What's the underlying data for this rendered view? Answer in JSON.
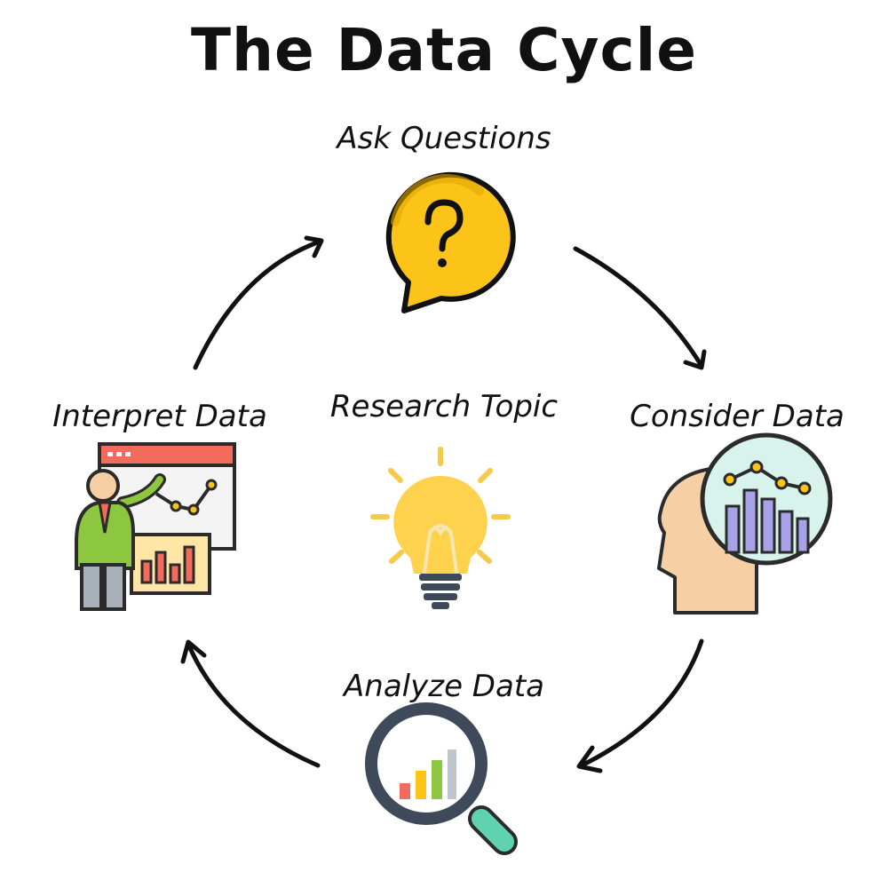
{
  "title": "The Data Cycle",
  "center": {
    "label": "Research Topic",
    "icon": "lightbulb-icon"
  },
  "steps": [
    {
      "label": "Ask Questions",
      "icon": "question-bubble-icon"
    },
    {
      "label": "Consider Data",
      "icon": "head-chart-icon"
    },
    {
      "label": "Analyze Data",
      "icon": "magnifier-chart-icon"
    },
    {
      "label": "Interpret Data",
      "icon": "presenter-icon"
    }
  ],
  "colors": {
    "yellow": "#FCC419",
    "yellow_dark": "#E0A800",
    "bulb": "#FFD24D",
    "bulb_rays": "#F7C948",
    "red": "#F26B5B",
    "green": "#8DC63F",
    "teal": "#5FD3B0",
    "skin": "#F6CFA4",
    "slate": "#3E4A5A",
    "purple": "#A8A3E8",
    "mint": "#D7F3EB"
  }
}
